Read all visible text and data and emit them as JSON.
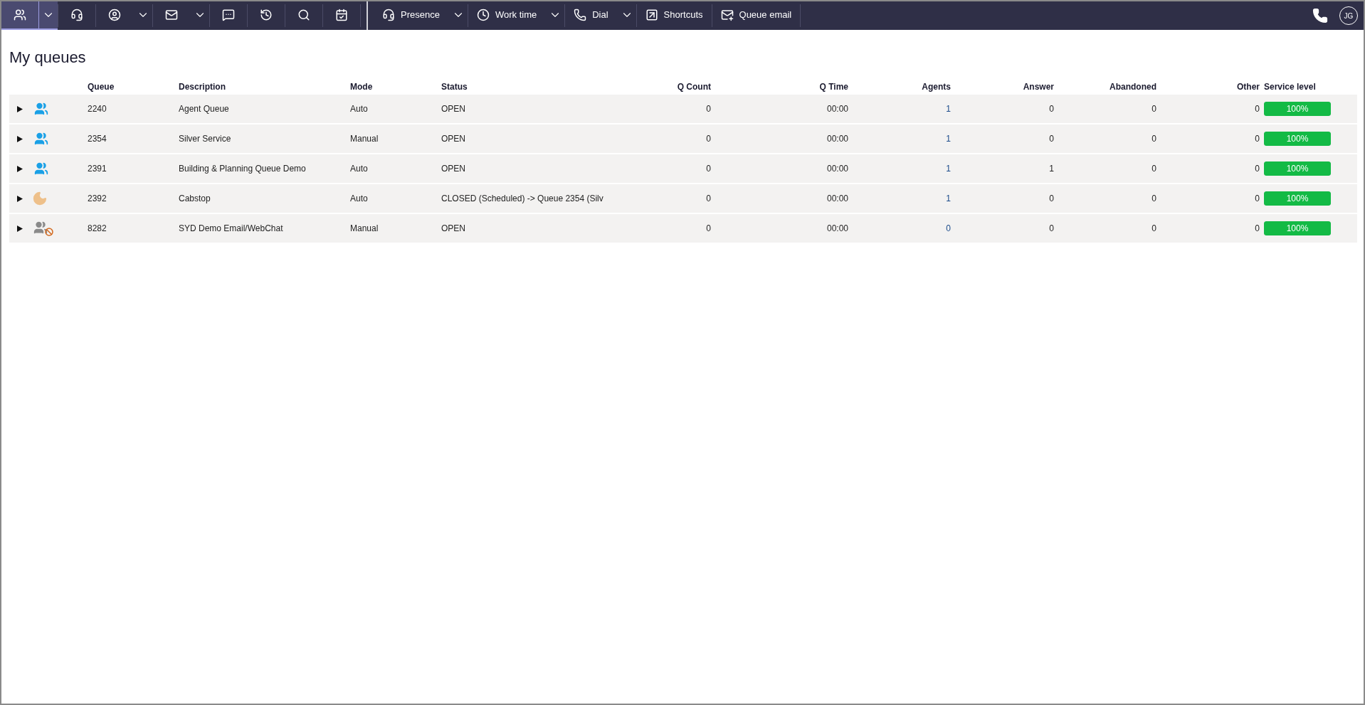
{
  "toolbar": {
    "buttons": [
      {
        "selected": true,
        "dropdown": true
      },
      {
        "selected": false,
        "dropdown": false
      },
      {
        "selected": false,
        "dropdown": true
      },
      {
        "selected": false,
        "dropdown": true
      },
      {
        "selected": false,
        "dropdown": false
      },
      {
        "selected": false,
        "dropdown": false
      },
      {
        "selected": false,
        "dropdown": false
      },
      {
        "selected": false,
        "dropdown": false
      },
      {
        "label": "Presence",
        "selected": false,
        "dropdown": true
      },
      {
        "label": "Work time",
        "selected": false,
        "dropdown": true
      },
      {
        "label": "Dial",
        "selected": false,
        "dropdown": true
      },
      {
        "label": "Shortcuts",
        "selected": false,
        "dropdown": false
      },
      {
        "label": "Queue email",
        "selected": false,
        "dropdown": false
      }
    ],
    "avatar": "JG"
  },
  "title": "My queues",
  "table": {
    "columns": [
      "Queue",
      "Description",
      "Mode",
      "Status",
      "Q Count",
      "Q Time",
      "Agents",
      "Answer",
      "Abandoned",
      "Other",
      "Service level"
    ],
    "rows": [
      {
        "kind": "open",
        "expanded": false,
        "cells": [
          "2240",
          "Agent Queue",
          "Auto",
          "OPEN",
          "0",
          "00:00",
          "1",
          "0",
          "0",
          "0"
        ],
        "service_level": {
          "level": 1,
          "reading": "100%"
        }
      },
      {
        "kind": "open",
        "expanded": false,
        "cells": [
          "2354",
          "Silver Service",
          "Manual",
          "OPEN",
          "0",
          "00:00",
          "1",
          "0",
          "0",
          "0"
        ],
        "service_level": {
          "level": 1,
          "reading": "100%"
        }
      },
      {
        "kind": "open",
        "expanded": false,
        "cells": [
          "2391",
          "Building & Planning Queue Demo",
          "Auto",
          "OPEN",
          "0",
          "00:00",
          "1",
          "1",
          "0",
          "0"
        ],
        "service_level": {
          "level": 1,
          "reading": "100%"
        }
      },
      {
        "kind": "closed",
        "expanded": false,
        "cells": [
          "2392",
          "Cabstop",
          "Auto",
          "CLOSED (Scheduled) -> Queue 2354 (Silv",
          "0",
          "00:00",
          "1",
          "0",
          "0",
          "0"
        ],
        "service_level": {
          "level": 1,
          "reading": "100%"
        }
      },
      {
        "kind": "no-agents",
        "expanded": false,
        "cells": [
          "8282",
          "SYD Demo Email/WebChat",
          "Manual",
          "OPEN",
          "0",
          "00:00",
          "0",
          "0",
          "0",
          "0"
        ],
        "service_level": {
          "level": 1,
          "reading": "100%"
        }
      }
    ]
  }
}
